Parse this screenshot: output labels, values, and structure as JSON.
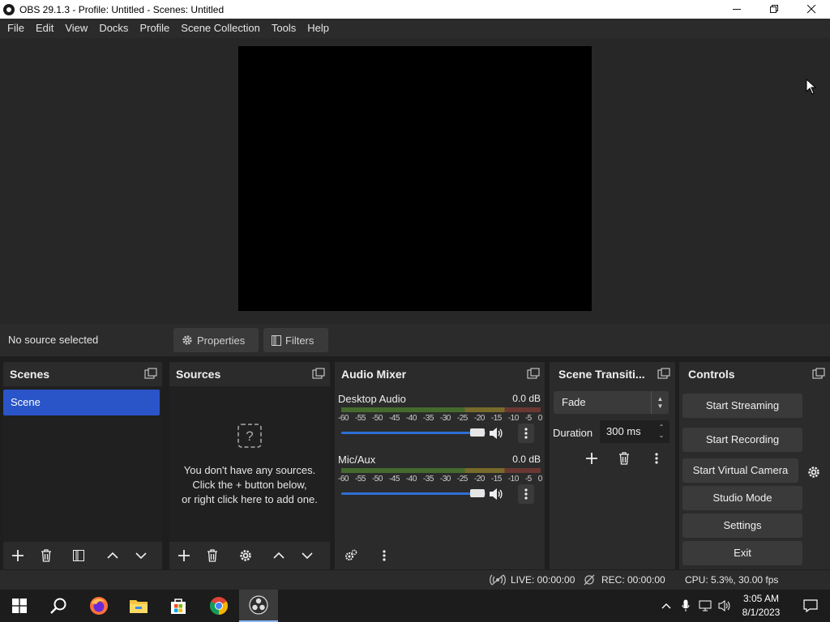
{
  "window": {
    "title": "OBS 29.1.3 - Profile: Untitled - Scenes: Untitled",
    "minimize_glyph": "—",
    "restore_glyph": "❐",
    "close_glyph": "✕"
  },
  "menu": [
    "File",
    "Edit",
    "View",
    "Docks",
    "Profile",
    "Scene Collection",
    "Tools",
    "Help"
  ],
  "source_toolbar": {
    "no_source": "No source selected",
    "properties": "Properties",
    "filters": "Filters"
  },
  "scenes": {
    "title": "Scenes",
    "items": [
      "Scene"
    ]
  },
  "sources": {
    "title": "Sources",
    "empty_line1": "You don't have any sources.",
    "empty_line2": "Click the + button below,",
    "empty_line3": "or right click here to add one."
  },
  "mixer": {
    "title": "Audio Mixer",
    "channels": [
      {
        "name": "Desktop Audio",
        "db": "0.0 dB",
        "volume": 1.0
      },
      {
        "name": "Mic/Aux",
        "db": "0.0 dB",
        "volume": 1.0
      }
    ],
    "scale": [
      "-60",
      "-55",
      "-50",
      "-45",
      "-40",
      "-35",
      "-30",
      "-25",
      "-20",
      "-15",
      "-10",
      "-5",
      "0"
    ]
  },
  "transitions": {
    "title": "Scene Transiti...",
    "selected": "Fade",
    "duration_label": "Duration",
    "duration_value": "300 ms"
  },
  "controls": {
    "title": "Controls",
    "start_streaming": "Start Streaming",
    "start_recording": "Start Recording",
    "start_virtual_camera": "Start Virtual Camera",
    "studio_mode": "Studio Mode",
    "settings": "Settings",
    "exit": "Exit"
  },
  "status": {
    "live": "LIVE: 00:00:00",
    "rec": "REC: 00:00:00",
    "cpu": "CPU: 5.3%, 30.00 fps"
  },
  "taskbar": {
    "time": "3:05 AM",
    "date": "8/1/2023",
    "icons": [
      "windows-start-icon",
      "search-icon",
      "firefox-icon",
      "file-explorer-icon",
      "microsoft-store-icon",
      "chrome-icon",
      "obs-icon"
    ]
  },
  "colors": {
    "selected_scene": "#2a55c8",
    "slider": "#2f6fd6",
    "panel": "#2b2b2b",
    "panel_body": "#202020"
  }
}
